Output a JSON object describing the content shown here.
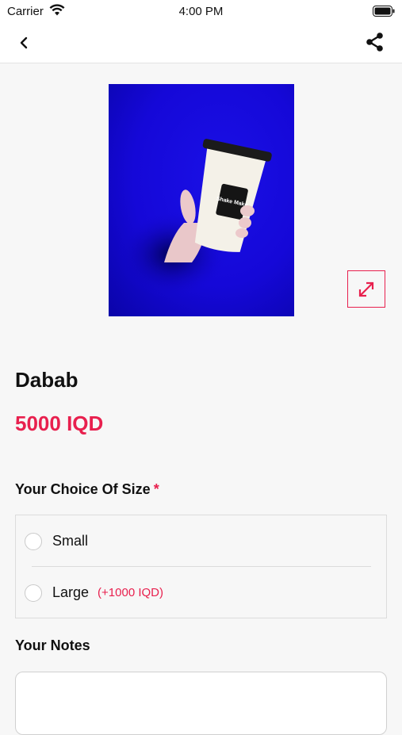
{
  "status_bar": {
    "carrier": "Carrier",
    "time": "4:00 PM",
    "wifi_icon": "wifi-icon",
    "battery_icon": "battery-icon"
  },
  "nav": {
    "back_icon": "chevron-left-icon",
    "share_icon": "share-icon"
  },
  "product": {
    "name": "Dabab",
    "price": "5000 IQD",
    "image_description_icon": "product-photo",
    "cup_text": "Shake Make",
    "expand_icon": "expand-icon"
  },
  "size_section": {
    "title": "Your Choice Of Size",
    "required_mark": "*",
    "options": [
      {
        "label": "Small",
        "extra": ""
      },
      {
        "label": "Large",
        "extra": "(+1000 IQD)"
      }
    ]
  },
  "notes_section": {
    "title": "Your Notes",
    "placeholder": ""
  },
  "colors": {
    "accent": "#e8204e",
    "image_bg": "#1508d8"
  }
}
